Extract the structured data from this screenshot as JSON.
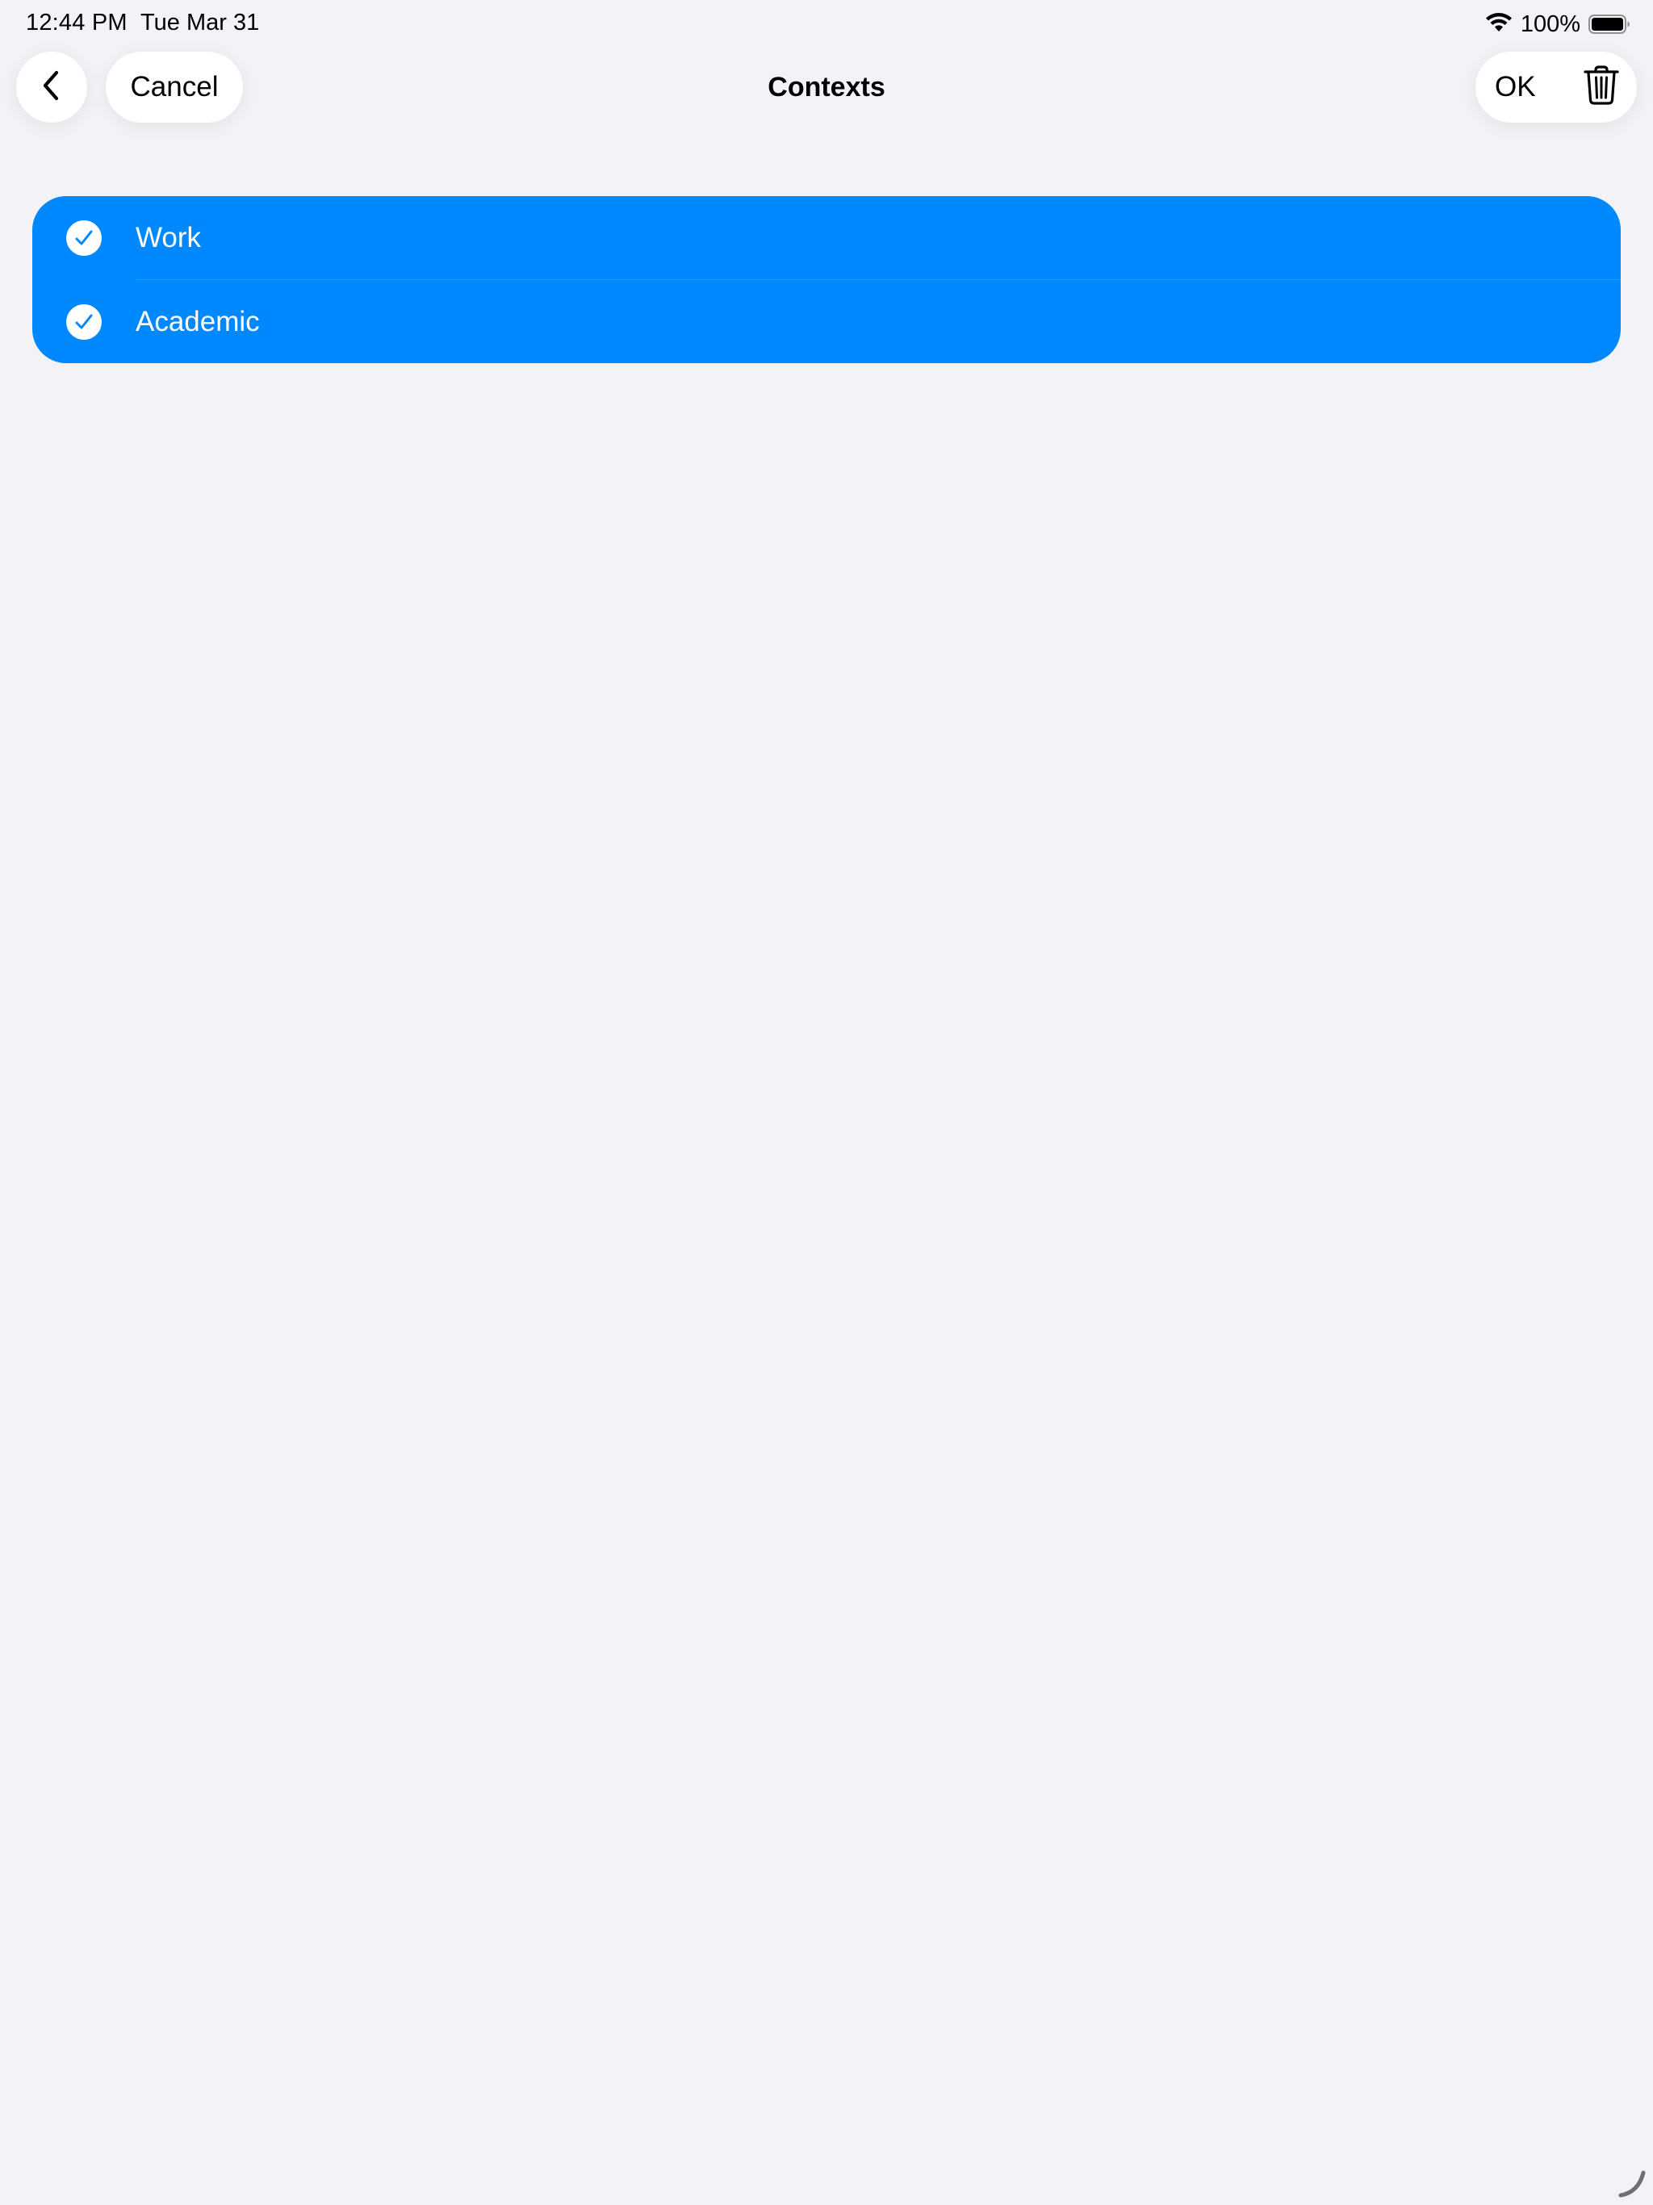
{
  "status_bar": {
    "time": "12:44 PM",
    "date": "Tue Mar 31",
    "battery_percent": "100%",
    "wifi_icon": "wifi-icon",
    "battery_icon": "battery-full-icon"
  },
  "nav": {
    "back_icon": "chevron-left-icon",
    "cancel_label": "Cancel",
    "title": "Contexts",
    "ok_label": "OK",
    "trash_icon": "trash-icon"
  },
  "list": {
    "accent_color": "#0088FF",
    "items": [
      {
        "label": "Work",
        "selected": true,
        "icon": "checkmark-circle-icon"
      },
      {
        "label": "Academic",
        "selected": true,
        "icon": "checkmark-circle-icon"
      }
    ]
  },
  "colors": {
    "background": "#F2F2F7",
    "selection": "#0088FF",
    "button_bg": "#FFFFFF"
  }
}
